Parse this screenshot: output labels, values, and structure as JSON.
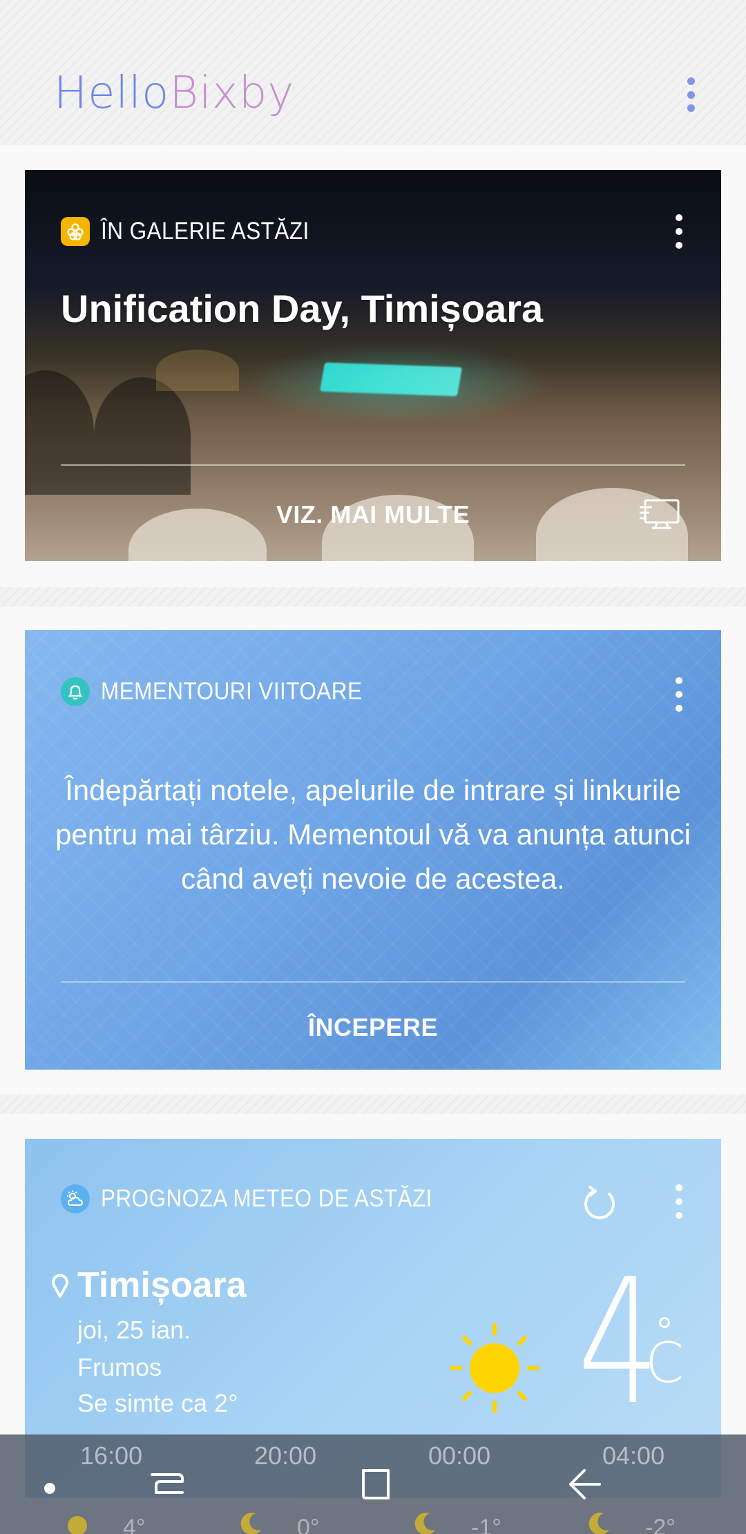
{
  "header": {
    "logo_part1": "Hello",
    "logo_part2": "Bixby",
    "menu_icon": "more-vert-icon"
  },
  "gallery_card": {
    "section_label": "ÎN GALERIE ASTĂZI",
    "title": "Unification Day, Timișoara",
    "action_label": "VIZ. MAI MULTE",
    "badge_color": "#f7b500",
    "icons": [
      "gallery-flower-icon",
      "more-vert-icon",
      "cast-to-tv-icon"
    ]
  },
  "reminder_card": {
    "section_label": "MEMENTOURI VIITOARE",
    "body": "Îndepărtați notele, apelurile de intrare și linkurile pentru mai târziu. Mementoul vă va anunța atunci când aveți nevoie de acestea.",
    "action_label": "ÎNCEPERE",
    "badge_color": "#34c3c0",
    "icons": [
      "bell-icon",
      "more-vert-icon"
    ]
  },
  "weather_card": {
    "section_label": "PROGNOZA METEO DE ASTĂZI",
    "city": "Timișoara",
    "date": "joi, 25 ian.",
    "condition": "Frumos",
    "feels_like": "Se simte ca 2°",
    "temperature": "4",
    "unit": "C",
    "sun_color": "#ffd400",
    "icons": [
      "weather-icon",
      "refresh-icon",
      "more-vert-icon",
      "location-pin-icon",
      "sun-icon"
    ],
    "forecast": [
      {
        "time": "16:00",
        "temp": "4°",
        "icon": "sun-icon"
      },
      {
        "time": "20:00",
        "temp": "0°",
        "icon": "moon-icon"
      },
      {
        "time": "00:00",
        "temp": "-1°",
        "icon": "moon-icon"
      },
      {
        "time": "04:00",
        "temp": "-2°",
        "icon": "moon-icon"
      }
    ]
  },
  "navbar": {
    "buttons": [
      "recent-apps-icon",
      "home-icon",
      "back-icon"
    ]
  }
}
